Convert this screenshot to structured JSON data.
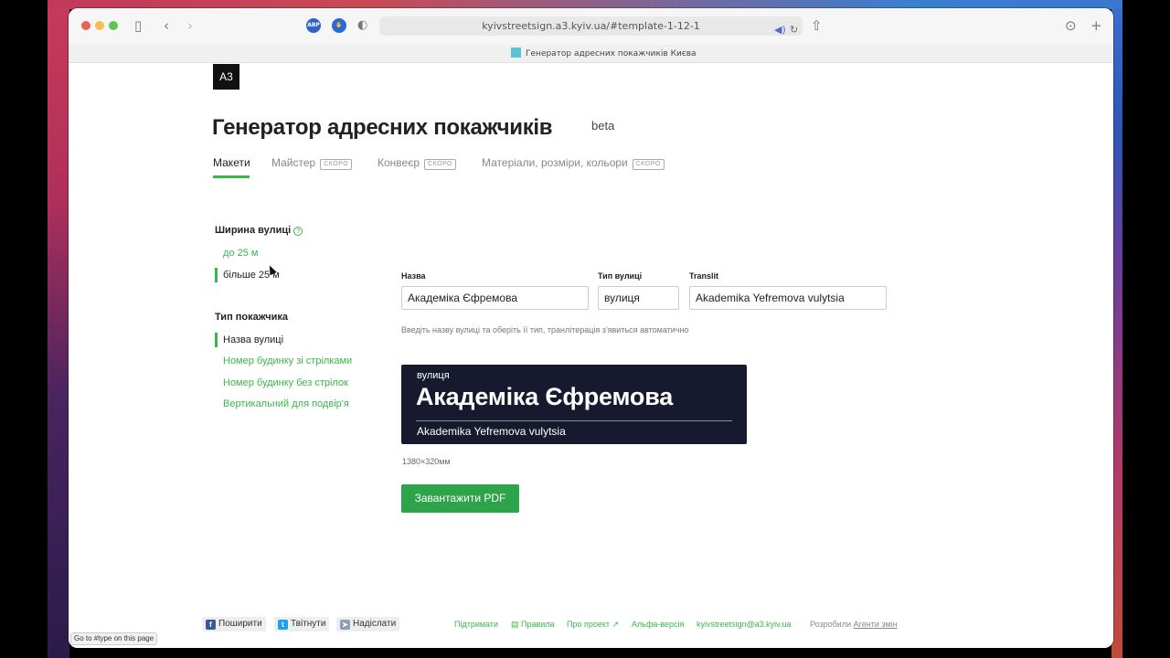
{
  "browser": {
    "url": "kyivstreetsign.a3.kyiv.ua/#template-1-12-1",
    "tab_title": "Генератор адресних покажчиків Києва",
    "status_text": "Go to #type on this page",
    "extensions": [
      "ABP",
      "1Blocker",
      "Privacy"
    ]
  },
  "header": {
    "logo": "A3",
    "title": "Генератор адресних покажчиків",
    "badge": "beta"
  },
  "nav": {
    "tabs": [
      {
        "label": "Макети",
        "soon": ""
      },
      {
        "label": "Майстер",
        "soon": "СКОРО"
      },
      {
        "label": "Конвеєр",
        "soon": "СКОРО"
      },
      {
        "label": "Матеріали, розміри, кольори",
        "soon": "СКОРО"
      }
    ]
  },
  "sidebar": {
    "width_heading": "Ширина вулиці",
    "width_help": "?",
    "width_options": [
      "до 25 м",
      "більше 25 м"
    ],
    "type_heading": "Тип покажчика",
    "type_options": [
      "Назва вулиці",
      "Номер будинку зі стрілками",
      "Номер будинку без стрілок",
      "Вертикальний для подвір'я"
    ]
  },
  "form": {
    "name_label": "Назва",
    "name_value": "Академіка Єфремова",
    "type_label": "Тип вулиці",
    "type_value": "вулиця",
    "translit_label": "Translit",
    "translit_value": "Akademika Yefremova vulytsia",
    "hint": "Введіть назву вулиці та оберіть її тип, транлітерація з'явиться автоматично"
  },
  "preview": {
    "sign_type": "вулиця",
    "sign_name": "Академіка Єфремова",
    "sign_translit": "Akademika Yefremova vulytsia",
    "dimensions": "1380×320мм",
    "download_label": "Завантажити PDF",
    "sign_bg": "#17192f"
  },
  "footer": {
    "share_facebook": "Поширити",
    "share_twitter": "Твітнути",
    "share_telegram": "Надіслати",
    "links": [
      "Підтримати",
      "Правила",
      "Про проект ↗",
      "Альфа-версія",
      "kyivstreetsign@a3.kyiv.ua"
    ],
    "credits_prefix": "Розробили",
    "credits_link": "Агенти змін"
  },
  "colors": {
    "accent": "#3cb64a",
    "button": "#2ea44a"
  }
}
